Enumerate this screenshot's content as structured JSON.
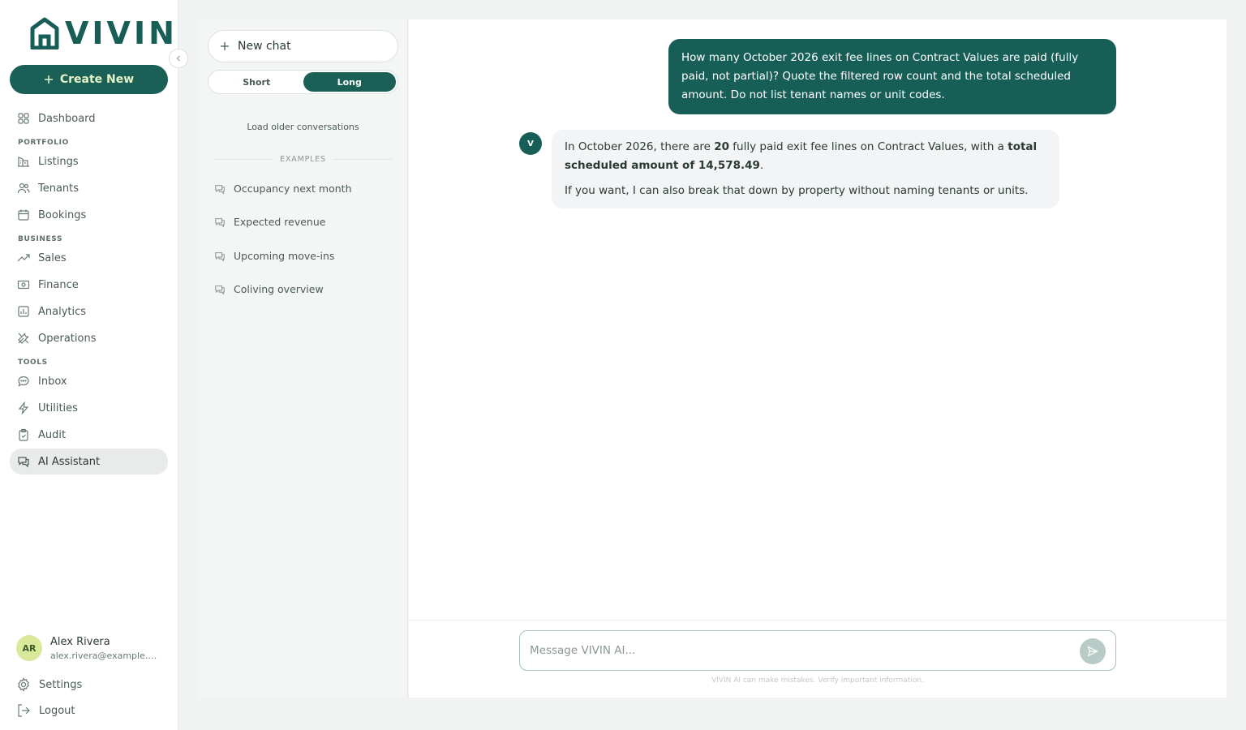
{
  "brand": {
    "name": "VIVIN",
    "accent": "#175f56"
  },
  "sidebar": {
    "create_label": "Create New",
    "dashboard": "Dashboard",
    "sections": {
      "portfolio": "PORTFOLIO",
      "business": "BUSINESS",
      "tools": "TOOLS"
    },
    "items": {
      "listings": "Listings",
      "tenants": "Tenants",
      "bookings": "Bookings",
      "sales": "Sales",
      "finance": "Finance",
      "analytics": "Analytics",
      "operations": "Operations",
      "inbox": "Inbox",
      "utilities": "Utilities",
      "audit": "Audit",
      "ai_assistant": "AI Assistant"
    },
    "user": {
      "initials": "AR",
      "name": "Alex Rivera",
      "email": "alex.rivera@example.com"
    },
    "settings": "Settings",
    "logout": "Logout"
  },
  "conversations": {
    "new_chat": "New chat",
    "length_options": [
      "Short",
      "Long"
    ],
    "length_selected": "Long",
    "load_older": "Load older conversations",
    "examples_heading": "EXAMPLES",
    "examples": [
      "Occupancy next month",
      "Expected revenue",
      "Upcoming move-ins",
      "Coliving overview"
    ]
  },
  "chat": {
    "user_message": "How many October 2026 exit fee lines on Contract Values are paid (fully paid, not partial)? Quote the filtered row count and the total scheduled amount. Do not list tenant names or unit codes.",
    "bot_avatar": "V",
    "bot": {
      "p1_a": "In October 2026, there are ",
      "p1_count": "20",
      "p1_b": " fully paid exit fee lines on Contract Values, with a ",
      "p1_total": "total scheduled amount of 14,578.49",
      "p1_c": ".",
      "p2": "If you want, I can also break that down by property without naming tenants or units."
    },
    "composer_placeholder": "Message VIVIN AI...",
    "disclaimer": "VIVIN AI can make mistakes. Verify important information."
  }
}
